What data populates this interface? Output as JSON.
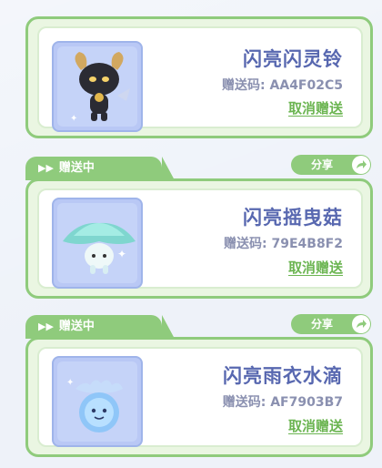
{
  "items": [
    {
      "name": "闪亮闪灵铃",
      "code": "赠送码: AA4F02C5",
      "cancel_label": "取消赠送",
      "icon": "dark-goat-creature-icon"
    },
    {
      "tag_label": "赠送中",
      "share_label": "分享",
      "name": "闪亮摇曳菇",
      "code": "赠送码: 79E4B8F2",
      "cancel_label": "取消赠送",
      "icon": "mint-mushroom-creature-icon"
    },
    {
      "tag_label": "赠送中",
      "share_label": "分享",
      "name": "闪亮雨衣水滴",
      "code": "赠送码: AF7903B7",
      "cancel_label": "取消赠送",
      "icon": "water-drop-creature-icon"
    }
  ],
  "colors": {
    "card_border": "#8fcb7c",
    "card_bg": "#eaf6e2",
    "name": "#5868b0",
    "code": "#8a90b0",
    "cancel": "#6cb552"
  }
}
